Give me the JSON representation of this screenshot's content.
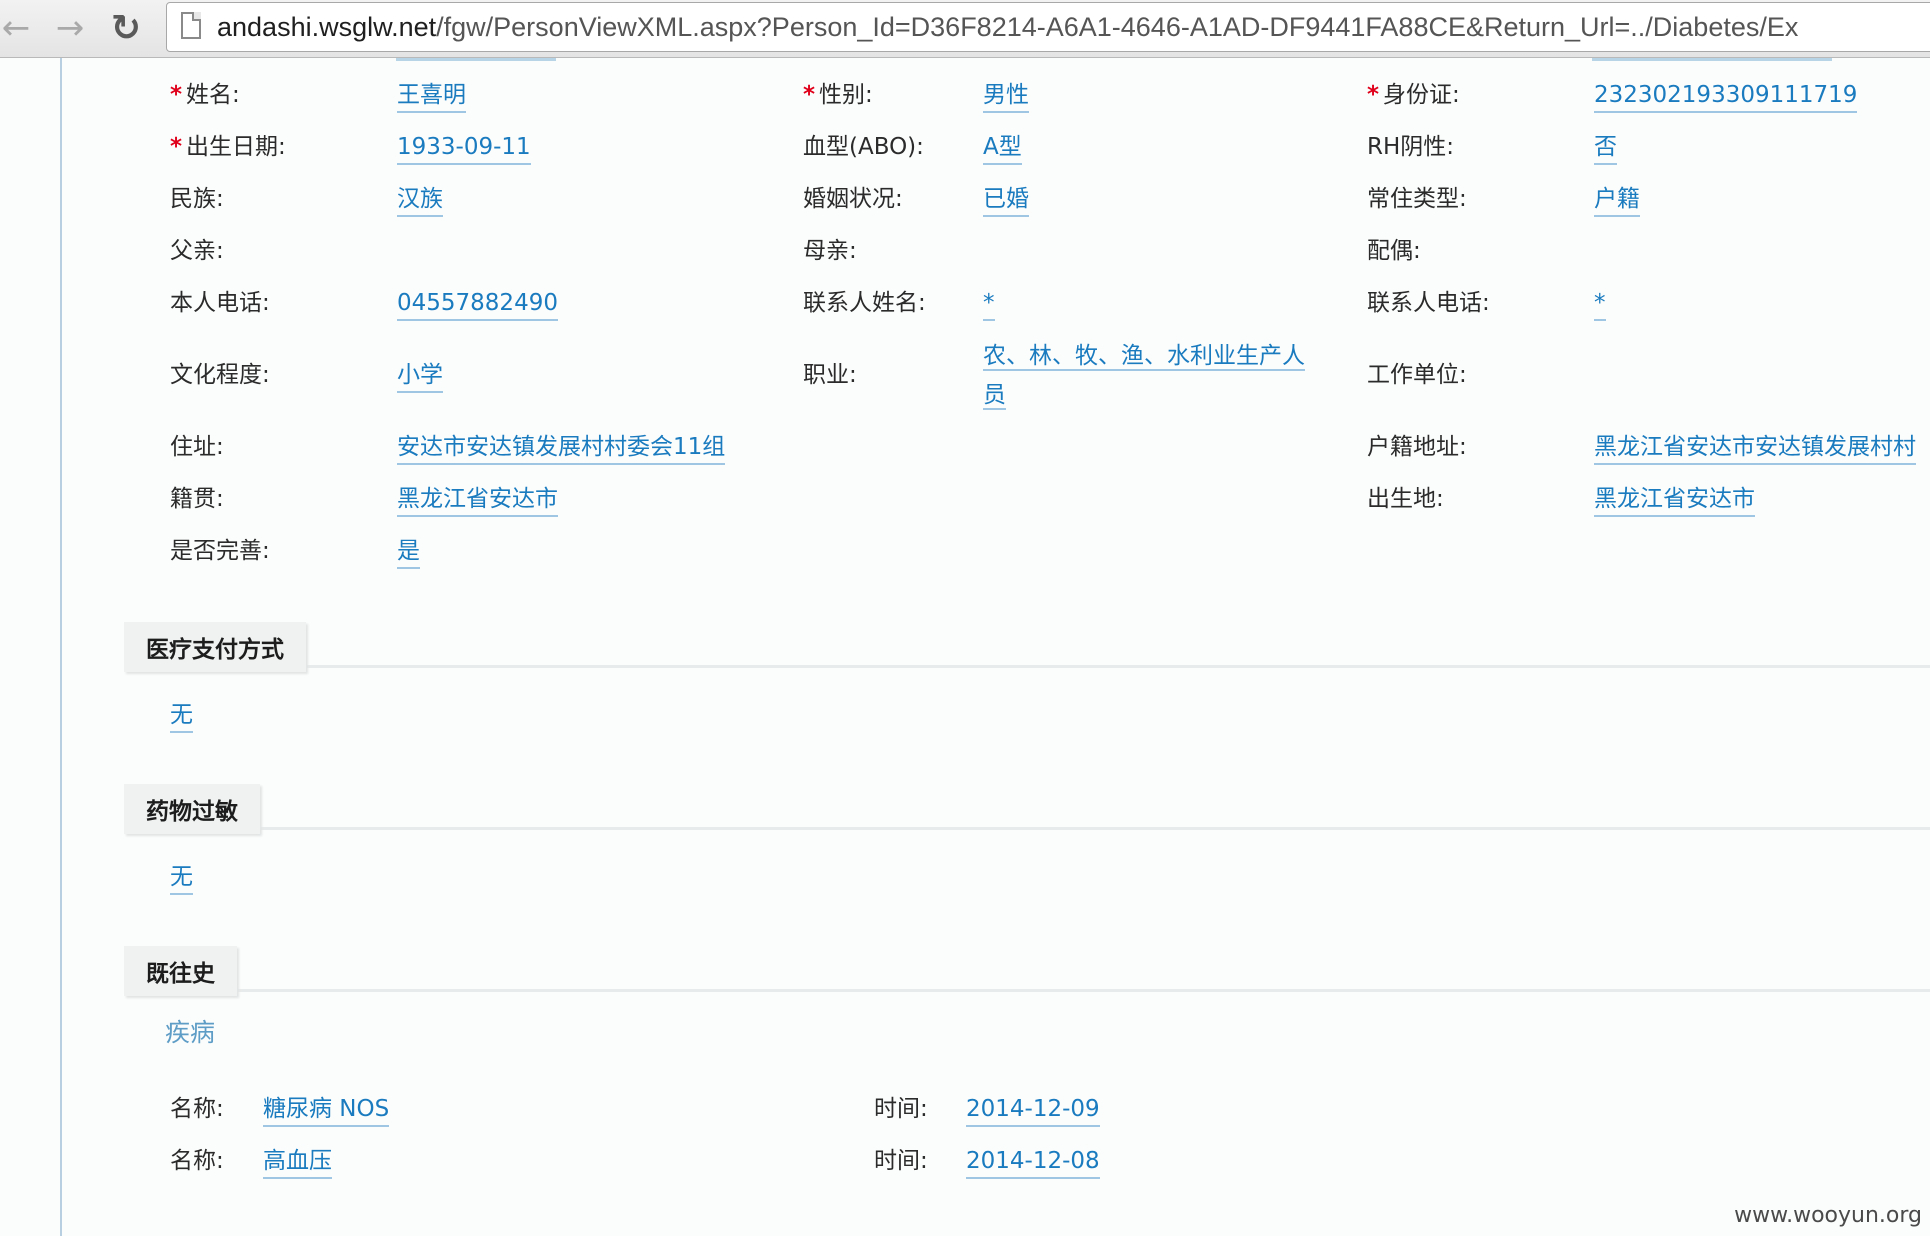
{
  "browser": {
    "url_host": "andashi.wsglw.net",
    "url_path": "/fgw/PersonViewXML.aspx?Person_Id=D36F8214-A6A1-4646-A1AD-DF9441FA88CE&Return_Url=../Diabetes/Ex"
  },
  "person": {
    "name_label": "姓名:",
    "name": "王喜明",
    "gender_label": "性别:",
    "gender": "男性",
    "id_label": "身份证:",
    "id_number": "232302193309111719",
    "birth_label": "出生日期:",
    "birth": "1933-09-11",
    "blood_label": "血型(ABO):",
    "blood": "A型",
    "rh_label": "RH阴性:",
    "rh": "否",
    "ethnic_label": "民族:",
    "ethnic": "汉族",
    "marital_label": "婚姻状况:",
    "marital": "已婚",
    "residence_label": "常住类型:",
    "residence": "户籍",
    "father_label": "父亲:",
    "mother_label": "母亲:",
    "spouse_label": "配偶:",
    "phone_label": "本人电话:",
    "phone": "04557882490",
    "contact_name_label": "联系人姓名:",
    "contact_name": "*",
    "contact_phone_label": "联系人电话:",
    "contact_phone": "*",
    "education_label": "文化程度:",
    "education": "小学",
    "occupation_label": "职业:",
    "occupation": "农、林、牧、渔、水利业生产人员",
    "workplace_label": "工作单位:",
    "address_label": "住址:",
    "address": "安达市安达镇发展村村委会11组",
    "huji_label": "户籍地址:",
    "huji": "黑龙江省安达市安达镇发展村村",
    "native_label": "籍贯:",
    "native": "黑龙江省安达市",
    "birthplace_label": "出生地:",
    "birthplace": "黑龙江省安达市",
    "complete_label": "是否完善:",
    "complete": "是"
  },
  "payment": {
    "title": "医疗支付方式",
    "value": "无"
  },
  "allergy": {
    "title": "药物过敏",
    "value": "无"
  },
  "history": {
    "title": "既往史",
    "sub_title": "疾病",
    "name_label": "名称:",
    "time_label": "时间:",
    "rows": [
      {
        "name": "糖尿病 NOS",
        "time": "2014-12-09"
      },
      {
        "name": "高血压",
        "time": "2014-12-08"
      }
    ]
  },
  "watermark": "www.wooyun.org"
}
